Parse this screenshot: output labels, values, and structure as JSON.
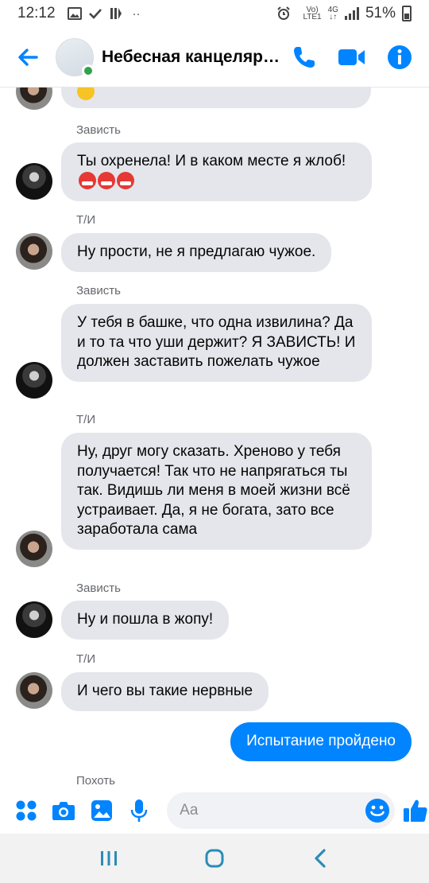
{
  "status_bar": {
    "time": "12:12",
    "network_top": "Vo)",
    "network_bottom": "LTE1",
    "gen_top": "4G",
    "gen_bottom": "↓↑",
    "battery": "51%"
  },
  "header": {
    "title": "Небесная канцелярия",
    "online": true
  },
  "messages": [
    {
      "sender": "Зависть",
      "text": "Ты охренела! И в каком месте я жлоб!",
      "emoji_count": 3,
      "avatar": "dark"
    },
    {
      "sender": "Т/И",
      "text": "Ну прости, не я предлагаю чужое.",
      "avatar": "girl"
    },
    {
      "sender": "Зависть",
      "text": "У тебя в башке, что одна извилина? Да и то та что уши держит? Я ЗАВИСТЬ! И должен заставить пожелать чужое",
      "avatar": "dark"
    },
    {
      "sender": "Т/И",
      "text": "Ну, друг могу сказать. Хреново у тебя получается! Так что не напрягаться ты так. Видишь ли меня в моей жизни всё устраивает. Да, я не богата, зато все заработала сама",
      "avatar": "girl"
    },
    {
      "sender": "Зависть",
      "text": "Ну и пошла в жопу!",
      "avatar": "dark"
    },
    {
      "sender": "Т/И",
      "text": "И чего вы такие нервные",
      "avatar": "girl"
    }
  ],
  "outgoing": {
    "text": "Испытание пройдено"
  },
  "next_sender": "Похоть",
  "composer": {
    "placeholder": "Aa"
  },
  "icons": {
    "back": "arrow-left-icon",
    "call": "phone-icon",
    "video": "video-camera-icon",
    "info": "info-icon",
    "apps": "grid-dots-icon",
    "camera": "camera-icon",
    "gallery": "image-icon",
    "mic": "microphone-icon",
    "emoji": "smiley-icon",
    "like": "thumbs-up-icon"
  },
  "colors": {
    "accent": "#0084ff",
    "incoming_bubble": "#e4e6eb",
    "online": "#31a24c"
  }
}
